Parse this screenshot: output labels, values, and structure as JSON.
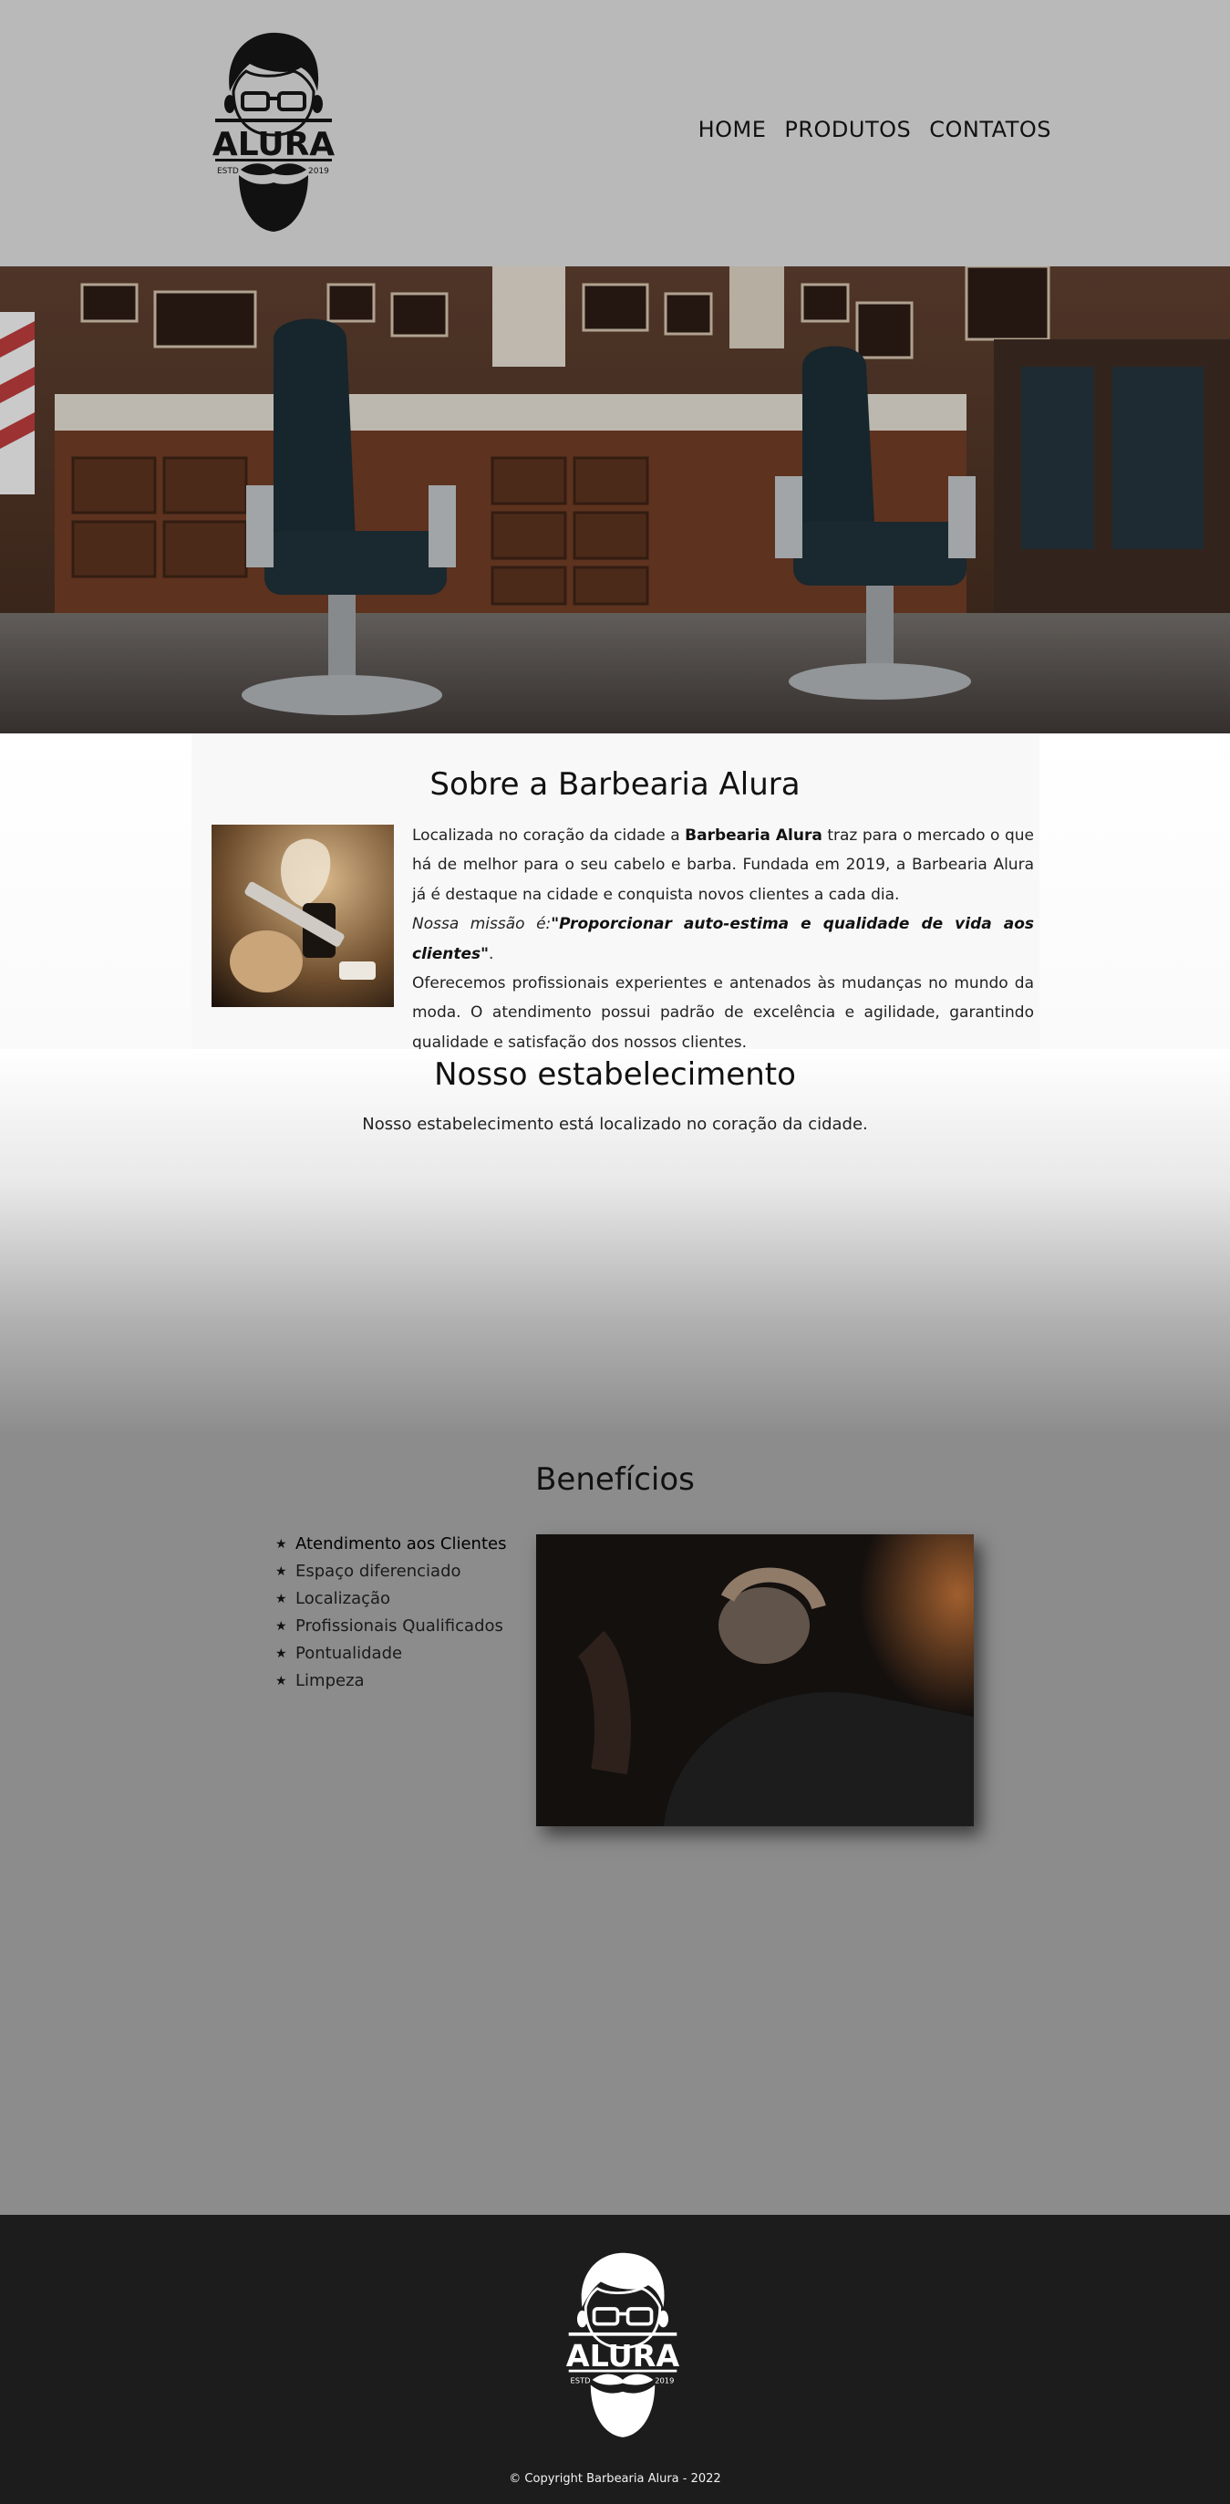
{
  "header": {
    "logo": {
      "brand": "ALURA",
      "estd": "ESTD",
      "year": "2019"
    },
    "nav": [
      {
        "label": "HOME"
      },
      {
        "label": "PRODUTOS"
      },
      {
        "label": "CONTATOS"
      }
    ]
  },
  "hero": {
    "image": "barbershop-interior-photo"
  },
  "sobre": {
    "title": "Sobre a Barbearia Alura",
    "image": "shaving-brush-and-razor-photo",
    "p1_before": "Localizada no coração da cidade a ",
    "p1_bold": "Barbearia Alura",
    "p1_after": " traz para o mercado o que há de melhor para o seu cabelo e barba. Fundada em 2019, a Barbearia Alura já é destaque na cidade e conquista novos clientes a cada dia.",
    "mission_label": "Nossa missão é:",
    "mission_quote": "\"Proporcionar auto-estima e qualidade de vida aos clientes\"",
    "mission_end": ".",
    "p2": "Oferecemos profissionais experientes e antenados às mudanças no mundo da moda. O atendimento possui padrão de excelência e agilidade, garantindo qualidade e satisfação dos nossos clientes."
  },
  "estabelecimento": {
    "title": "Nosso estabelecimento",
    "text": "Nosso estabelecimento está localizado no coração da cidade."
  },
  "beneficios": {
    "title": "Benefícios",
    "items": [
      "Atendimento aos Clientes",
      "Espaço diferenciado",
      "Localização",
      "Profissionais Qualificados",
      "Pontualidade",
      "Limpeza"
    ],
    "image": "barber-shaving-client-photo"
  },
  "footer": {
    "logo": {
      "brand": "ALURA",
      "estd": "ESTD",
      "year": "2019"
    },
    "copyright": "© Copyright Barbearia Alura - 2022"
  },
  "colors": {
    "header_bg": "#b9b9b9",
    "section_gray": "#8c8c8c",
    "footer_bg": "#1c1c1c",
    "text": "#111111"
  }
}
